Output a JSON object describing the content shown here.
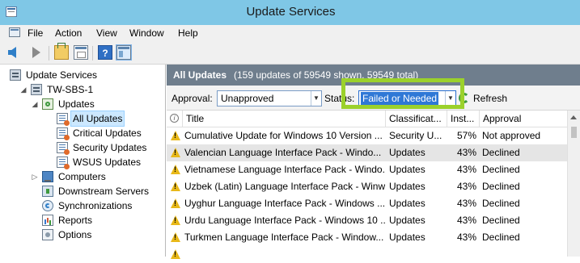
{
  "window": {
    "title": "Update Services"
  },
  "menu": [
    "File",
    "Action",
    "View",
    "Window",
    "Help"
  ],
  "tree": {
    "root": "Update Services",
    "server": "TW-SBS-1",
    "updates": "Updates",
    "all_updates": "All Updates",
    "critical_updates": "Critical Updates",
    "security_updates": "Security Updates",
    "wsus_updates": "WSUS Updates",
    "computers": "Computers",
    "downstream_servers": "Downstream Servers",
    "synchronizations": "Synchronizations",
    "reports": "Reports",
    "options": "Options"
  },
  "panel": {
    "title": "All Updates",
    "subtitle": "(159 updates of 59549 shown, 59549 total)"
  },
  "filter": {
    "approval_label": "Approval:",
    "approval_value": "Unapproved",
    "status_label": "Status:",
    "status_value": "Failed or Needed",
    "refresh_label": "Refresh"
  },
  "columns": {
    "title": "Title",
    "classification": "Classificat...",
    "installed": "Inst...",
    "approval": "Approval"
  },
  "rows": [
    {
      "title": "Cumulative Update for Windows 10 Version ...",
      "classification": "Security U...",
      "installed": "57%",
      "approval": "Not approved"
    },
    {
      "title": "Valencian Language Interface Pack - Windo...",
      "classification": "Updates",
      "installed": "43%",
      "approval": "Declined"
    },
    {
      "title": "Vietnamese Language Interface Pack - Windo...",
      "classification": "Updates",
      "installed": "43%",
      "approval": "Declined"
    },
    {
      "title": "Uzbek (Latin) Language Interface Pack - Winw...",
      "classification": "Updates",
      "installed": "43%",
      "approval": "Declined"
    },
    {
      "title": "Uyghur Language Interface Pack - Windows ...",
      "classification": "Updates",
      "installed": "43%",
      "approval": "Declined"
    },
    {
      "title": "Urdu Language Interface Pack - Windows 10 ...",
      "classification": "Updates",
      "installed": "43%",
      "approval": "Declined"
    },
    {
      "title": "Turkmen Language Interface Pack - Window...",
      "classification": "Updates",
      "installed": "43%",
      "approval": "Declined"
    },
    {
      "title": "",
      "classification": "",
      "installed": "",
      "approval": ""
    }
  ],
  "colors": {
    "titlebar": "#7fc7e6",
    "header_strip": "#6f7e8d",
    "highlight": "#9bd12b",
    "selection": "#cce8ff",
    "warning": "#e8b818"
  },
  "icons": {
    "toolbar": [
      "back-arrow-icon",
      "forward-arrow-icon",
      "up-folder-icon",
      "show-hide-console-tree-icon",
      "help-icon",
      "show-hide-action-pane-icon"
    ],
    "row": "warning-icon",
    "refresh": "refresh-icon"
  }
}
